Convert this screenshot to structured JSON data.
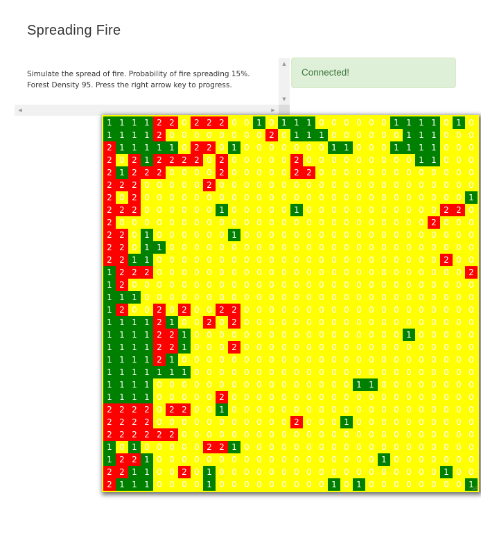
{
  "page": {
    "title": "Spreading Fire"
  },
  "description": {
    "text": "Simulate the spread of fire. Probability of fire spreading 15%.\nForest Density 95. Press the right arrow key to progress."
  },
  "status": {
    "message": "Connected!"
  },
  "colors": {
    "empty": "#ffff00",
    "tree": "#008000",
    "burning": "#ff0000",
    "status_bg": "#dff0d8",
    "status_text": "#3c763d"
  },
  "icons": {
    "scroll_up": "▲",
    "scroll_down": "▼",
    "scroll_left": "◀",
    "scroll_right": "▶"
  },
  "grid": {
    "rows": [
      "111122022200101110000001111010",
      "111120000000020111000000111000",
      "211111022010000000110001111000",
      "202122220200000200000000011000",
      "212220000200000220000000000000",
      "222000002000000000000000000000",
      "202000000000000000000000000001",
      "222000000100000100000000000220",
      "200000000000000000000000002000",
      "220100000010000000000000000000",
      "220110000000000000000000000000",
      "221100000000000000000000000200",
      "122200000000000000000000000002",
      "120000000000000000000000000000",
      "111000000000000000000000000000",
      "120020200220000000000000000000",
      "111121002020000000000000000000",
      "111122100000000000000000100000",
      "111122100020000000000000000000",
      "111121000000000000000000000000",
      "111111100000000000000000000000",
      "111100000000000000001100000000",
      "111100000200000000000000000000",
      "222202200100000000000000000000",
      "222200000000000200010000000000",
      "222222000000000000000000000000",
      "101000002210000000000000000000",
      "122100000000000000000010000000",
      "221100201000000000000000000100",
      "211100001000000000101000000001"
    ]
  }
}
